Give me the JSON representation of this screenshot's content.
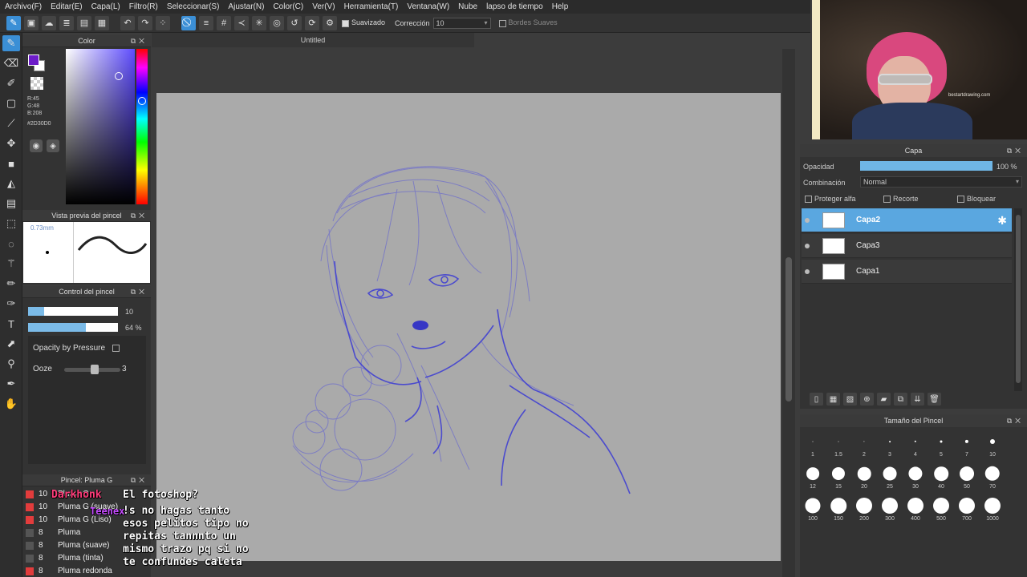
{
  "menu": [
    "Archivo(F)",
    "Editar(E)",
    "Capa(L)",
    "Filtro(R)",
    "Seleccionar(S)",
    "Ajustar(N)",
    "Color(C)",
    "Ver(V)",
    "Herramienta(T)",
    "Ventana(W)",
    "Nube",
    "lapso de tiempo",
    "Help"
  ],
  "toolbar": {
    "smooth_label": "Suavizado",
    "correction_label": "Corrección",
    "correction_value": "10",
    "soft_edges_label": "Bordes Suaves"
  },
  "document": {
    "title": "Untitled"
  },
  "color_panel": {
    "title": "Color",
    "rgb": [
      "R:45",
      "G:48",
      "B:208"
    ],
    "hex": "#2D30D0",
    "fg_color": "#6d1cc9"
  },
  "brush_preview": {
    "title": "Vista previa del pincel",
    "size": "0.73mm"
  },
  "brush_control": {
    "title": "Control del pincel",
    "size_value": "10",
    "size_fill": 0.18,
    "opacity_value": "64 %",
    "opacity_fill": 0.64,
    "opacity_pressure_label": "Opacity by Pressure",
    "ooze_label": "Ooze",
    "ooze_value": "3"
  },
  "brush_list": {
    "title": "Pincel: Pluma G",
    "items": [
      {
        "num": "10",
        "name": "Pluma G",
        "color": "red"
      },
      {
        "num": "10",
        "name": "Pluma G (suave)",
        "color": "red"
      },
      {
        "num": "10",
        "name": "Pluma G (Liso)",
        "color": "red"
      },
      {
        "num": "8",
        "name": "Pluma",
        "color": "gray"
      },
      {
        "num": "8",
        "name": "Pluma (suave)",
        "color": "gray"
      },
      {
        "num": "8",
        "name": "Pluma (tinta)",
        "color": "gray"
      },
      {
        "num": "8",
        "name": "Pluma redonda",
        "color": "red"
      }
    ]
  },
  "layer_panel": {
    "title": "Capa",
    "opacity_label": "Opacidad",
    "opacity_value": "100 %",
    "blend_label": "Combinación",
    "blend_value": "Normal",
    "protect_alpha": "Proteger alfa",
    "clipping": "Recorte",
    "lock": "Bloquear",
    "layers": [
      {
        "name": "Capa2",
        "selected": true
      },
      {
        "name": "Capa3",
        "selected": false
      },
      {
        "name": "Capa1",
        "selected": false
      }
    ]
  },
  "brush_size": {
    "title": "Tamaño del Pincel",
    "sizes": [
      "1",
      "1.5",
      "2",
      "3",
      "4",
      "5",
      "7",
      "10",
      "12",
      "15",
      "20",
      "25",
      "30",
      "40",
      "50",
      "70",
      "100",
      "150",
      "200",
      "300",
      "400",
      "500",
      "700",
      "1000"
    ]
  },
  "webcam": {
    "sign_text": "bestartdrawing.com"
  },
  "chat": {
    "user1": "Darkhonk",
    "msg1": "El fotoshop?",
    "user2": "Teenex",
    "msg2": "!s no hagas tanto\nesos pelitos tipo no\nrepitas tannnto un\nmismo trazo pq si no\nte confundes caleta"
  }
}
